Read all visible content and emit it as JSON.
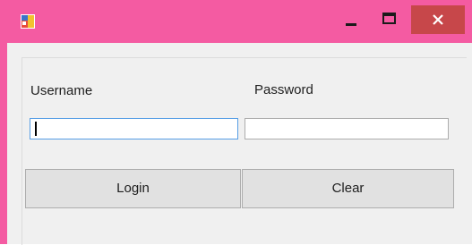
{
  "window": {
    "title": "",
    "titlebar_color": "#f45ba2",
    "close_hover_color": "#c7474a",
    "controls": {
      "minimize": "minimize-icon",
      "maximize": "maximize-icon",
      "close": "close-icon"
    }
  },
  "form": {
    "username_label": "Username",
    "password_label": "Password",
    "username_value": "",
    "password_value": "",
    "login_label": "Login",
    "clear_label": "Clear"
  }
}
